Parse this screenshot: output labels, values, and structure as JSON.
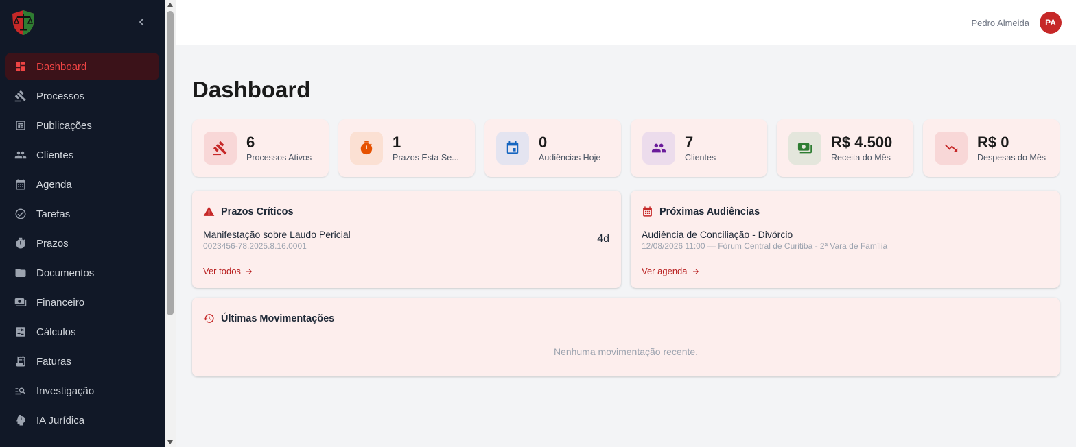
{
  "sidebar": {
    "items": [
      {
        "label": "Dashboard",
        "icon": "dashboard-icon",
        "active": true
      },
      {
        "label": "Processos",
        "icon": "gavel-icon"
      },
      {
        "label": "Publicações",
        "icon": "newspaper-icon"
      },
      {
        "label": "Clientes",
        "icon": "people-icon"
      },
      {
        "label": "Agenda",
        "icon": "calendar-icon"
      },
      {
        "label": "Tarefas",
        "icon": "check-circle-icon"
      },
      {
        "label": "Prazos",
        "icon": "timer-icon"
      },
      {
        "label": "Documentos",
        "icon": "folder-icon"
      },
      {
        "label": "Financeiro",
        "icon": "money-icon"
      },
      {
        "label": "Cálculos",
        "icon": "calculator-icon"
      },
      {
        "label": "Faturas",
        "icon": "invoice-icon"
      },
      {
        "label": "Investigação",
        "icon": "search-list-icon"
      },
      {
        "label": "IA Jurídica",
        "icon": "ai-brain-icon"
      }
    ]
  },
  "header": {
    "user_name": "Pedro Almeida",
    "avatar_initials": "PA"
  },
  "page": {
    "title": "Dashboard"
  },
  "stats": [
    {
      "value": "6",
      "label": "Processos Ativos",
      "icon": "gavel-icon",
      "color": "#c62828",
      "bg": "#f8d7d7"
    },
    {
      "value": "1",
      "label": "Prazos Esta Se...",
      "icon": "timer-icon",
      "color": "#e65100",
      "bg": "#fbe0d3"
    },
    {
      "value": "0",
      "label": "Audiências Hoje",
      "icon": "calendar-icon",
      "color": "#1565c0",
      "bg": "#e4e4f0"
    },
    {
      "value": "7",
      "label": "Clientes",
      "icon": "people-icon",
      "color": "#6a1b9a",
      "bg": "#ecdcec"
    },
    {
      "value": "R$ 4.500",
      "label": "Receita do Mês",
      "icon": "money-icon",
      "color": "#2e7d32",
      "bg": "#e4e6dc"
    },
    {
      "value": "R$ 0",
      "label": "Despesas do Mês",
      "icon": "trending-down-icon",
      "color": "#c62828",
      "bg": "#f8d7d7"
    }
  ],
  "deadlines": {
    "title": "Prazos Críticos",
    "item_title": "Manifestação sobre Laudo Pericial",
    "item_sub": "0023456-78.2025.8.16.0001",
    "badge": "4d",
    "link": "Ver todos"
  },
  "hearings": {
    "title": "Próximas Audiências",
    "item_title": "Audiência de Conciliação - Divórcio",
    "item_sub": "12/08/2026 11:00 — Fórum Central de Curitiba - 2ª Vara de Família",
    "link": "Ver agenda"
  },
  "movements": {
    "title": "Últimas Movimentações",
    "empty": "Nenhuma movimentação recente."
  },
  "colors": {
    "accent": "#c62828",
    "sidebar_bg": "#111827",
    "card_bg": "#fdeeed"
  }
}
